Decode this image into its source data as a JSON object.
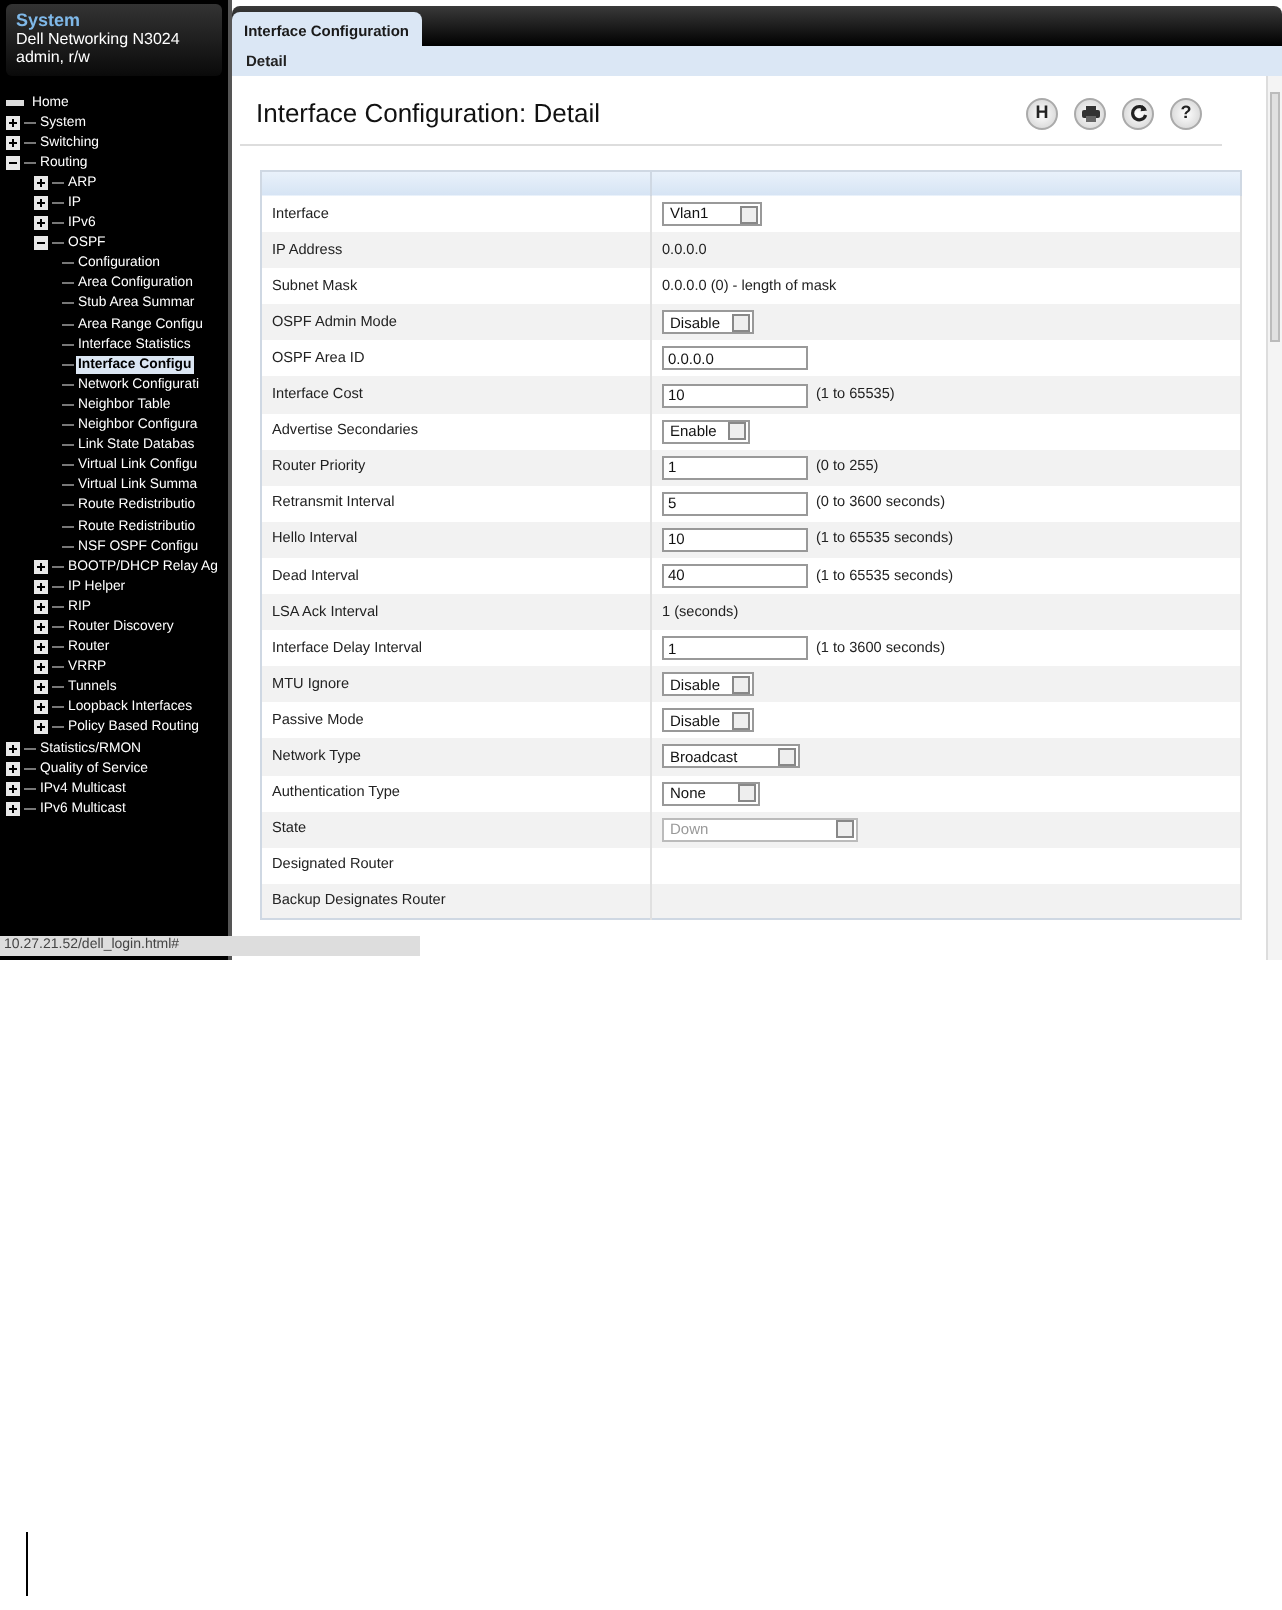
{
  "sidebar": {
    "title": "System",
    "device": "Dell Networking N3024",
    "user": "admin, r/w",
    "tree": [
      {
        "label": "Home",
        "selected": false
      },
      {
        "label": "System",
        "expanded": false,
        "selected": false
      },
      {
        "label": "Switching",
        "expanded": false,
        "selected": false
      },
      {
        "label": "Routing",
        "expanded": true,
        "selected": false,
        "children": [
          {
            "label": "ARP",
            "expanded": false,
            "selected": false
          },
          {
            "label": "IP",
            "expanded": false,
            "selected": false
          },
          {
            "label": "IPv6",
            "expanded": false,
            "selected": false
          },
          {
            "label": "OSPF",
            "expanded": true,
            "selected": false,
            "children": [
              {
                "label": "Configuration",
                "selected": false
              },
              {
                "label": "Area Configuration",
                "selected": false
              },
              {
                "label": "Stub Area Summar",
                "selected": false
              },
              {
                "label": "Area Range Configu",
                "selected": false
              },
              {
                "label": "Interface Statistics",
                "selected": false
              },
              {
                "label": "Interface Configu",
                "selected": true
              },
              {
                "label": "Network Configurati",
                "selected": false
              },
              {
                "label": "Neighbor Table",
                "selected": false
              },
              {
                "label": "Neighbor Configura",
                "selected": false
              },
              {
                "label": "Link State Databas",
                "selected": false
              },
              {
                "label": "Virtual Link Configu",
                "selected": false
              },
              {
                "label": "Virtual Link Summa",
                "selected": false
              },
              {
                "label": "Route Redistributio",
                "selected": false
              },
              {
                "label": "Route Redistributio",
                "selected": false
              },
              {
                "label": "NSF OSPF Configu",
                "selected": false
              }
            ]
          },
          {
            "label": "BOOTP/DHCP Relay Ag",
            "expanded": false,
            "selected": false
          },
          {
            "label": "IP Helper",
            "expanded": false,
            "selected": false
          },
          {
            "label": "RIP",
            "expanded": false,
            "selected": false
          },
          {
            "label": "Router Discovery",
            "expanded": false,
            "selected": false
          },
          {
            "label": "Router",
            "expanded": false,
            "selected": false
          },
          {
            "label": "VRRP",
            "expanded": false,
            "selected": false
          },
          {
            "label": "Tunnels",
            "expanded": false,
            "selected": false
          },
          {
            "label": "Loopback Interfaces",
            "expanded": false,
            "selected": false
          },
          {
            "label": "Policy Based Routing",
            "expanded": false,
            "selected": false
          }
        ]
      },
      {
        "label": "Statistics/RMON",
        "expanded": false,
        "selected": false
      },
      {
        "label": "Quality of Service",
        "expanded": false,
        "selected": false
      },
      {
        "label": "IPv4 Multicast",
        "expanded": false,
        "selected": false
      },
      {
        "label": "IPv6 Multicast",
        "expanded": false,
        "selected": false
      }
    ]
  },
  "tabs": [
    {
      "label": "Interface Configuration",
      "selected": true
    }
  ],
  "subtabs": [
    {
      "label": "Detail",
      "selected": true
    }
  ],
  "page_title": "Interface Configuration: Detail",
  "toolbar": [
    {
      "kind": "text",
      "label": "H"
    },
    {
      "kind": "print"
    },
    {
      "kind": "refresh"
    },
    {
      "kind": "text",
      "label": "?"
    }
  ],
  "rows": [
    {
      "label": "Interface",
      "kind": "select",
      "value": "Vlan1"
    },
    {
      "label": "IP Address",
      "kind": "text",
      "value": "0.0.0.0"
    },
    {
      "label": "Subnet Mask",
      "kind": "text",
      "value": "0.0.0.0  (0) - length of mask"
    },
    {
      "label": "OSPF Admin Mode",
      "kind": "select",
      "value": "Disable"
    },
    {
      "label": "OSPF Area ID",
      "kind": "input",
      "value": "0.0.0.0"
    },
    {
      "label": "Interface Cost",
      "kind": "input",
      "value": "10",
      "hint": "(1 to 65535)"
    },
    {
      "label": "Advertise Secondaries",
      "kind": "select",
      "value": "Enable"
    },
    {
      "label": "Router Priority",
      "kind": "input",
      "value": "1",
      "hint": "(0 to 255)"
    },
    {
      "label": "Retransmit Interval",
      "kind": "input",
      "value": "5",
      "hint": "(0 to 3600 seconds)"
    },
    {
      "label": "Hello Interval",
      "kind": "input",
      "value": "10",
      "hint": "(1 to 65535 seconds)"
    },
    {
      "label": "Dead Interval",
      "kind": "input",
      "value": "40",
      "hint": "(1 to 65535 seconds)"
    },
    {
      "label": "LSA Ack Interval",
      "kind": "text",
      "value": "1  (seconds)"
    },
    {
      "label": "Interface Delay Interval",
      "kind": "input",
      "value": "1",
      "hint": "(1 to 3600 seconds)"
    },
    {
      "label": "MTU Ignore",
      "kind": "select",
      "value": "Disable"
    },
    {
      "label": "Passive Mode",
      "kind": "select",
      "value": "Disable"
    },
    {
      "label": "Network Type",
      "kind": "select",
      "value": "Broadcast"
    },
    {
      "label": "Authentication Type",
      "kind": "select",
      "value": "None"
    },
    {
      "label": "State",
      "kind": "select",
      "value": "Down",
      "disabled": true
    },
    {
      "label": "Designated Router",
      "kind": "text"
    },
    {
      "label": "Backup Designates Router",
      "kind": "text"
    }
  ],
  "status_bar": "10.27.21.52/dell_login.html#"
}
